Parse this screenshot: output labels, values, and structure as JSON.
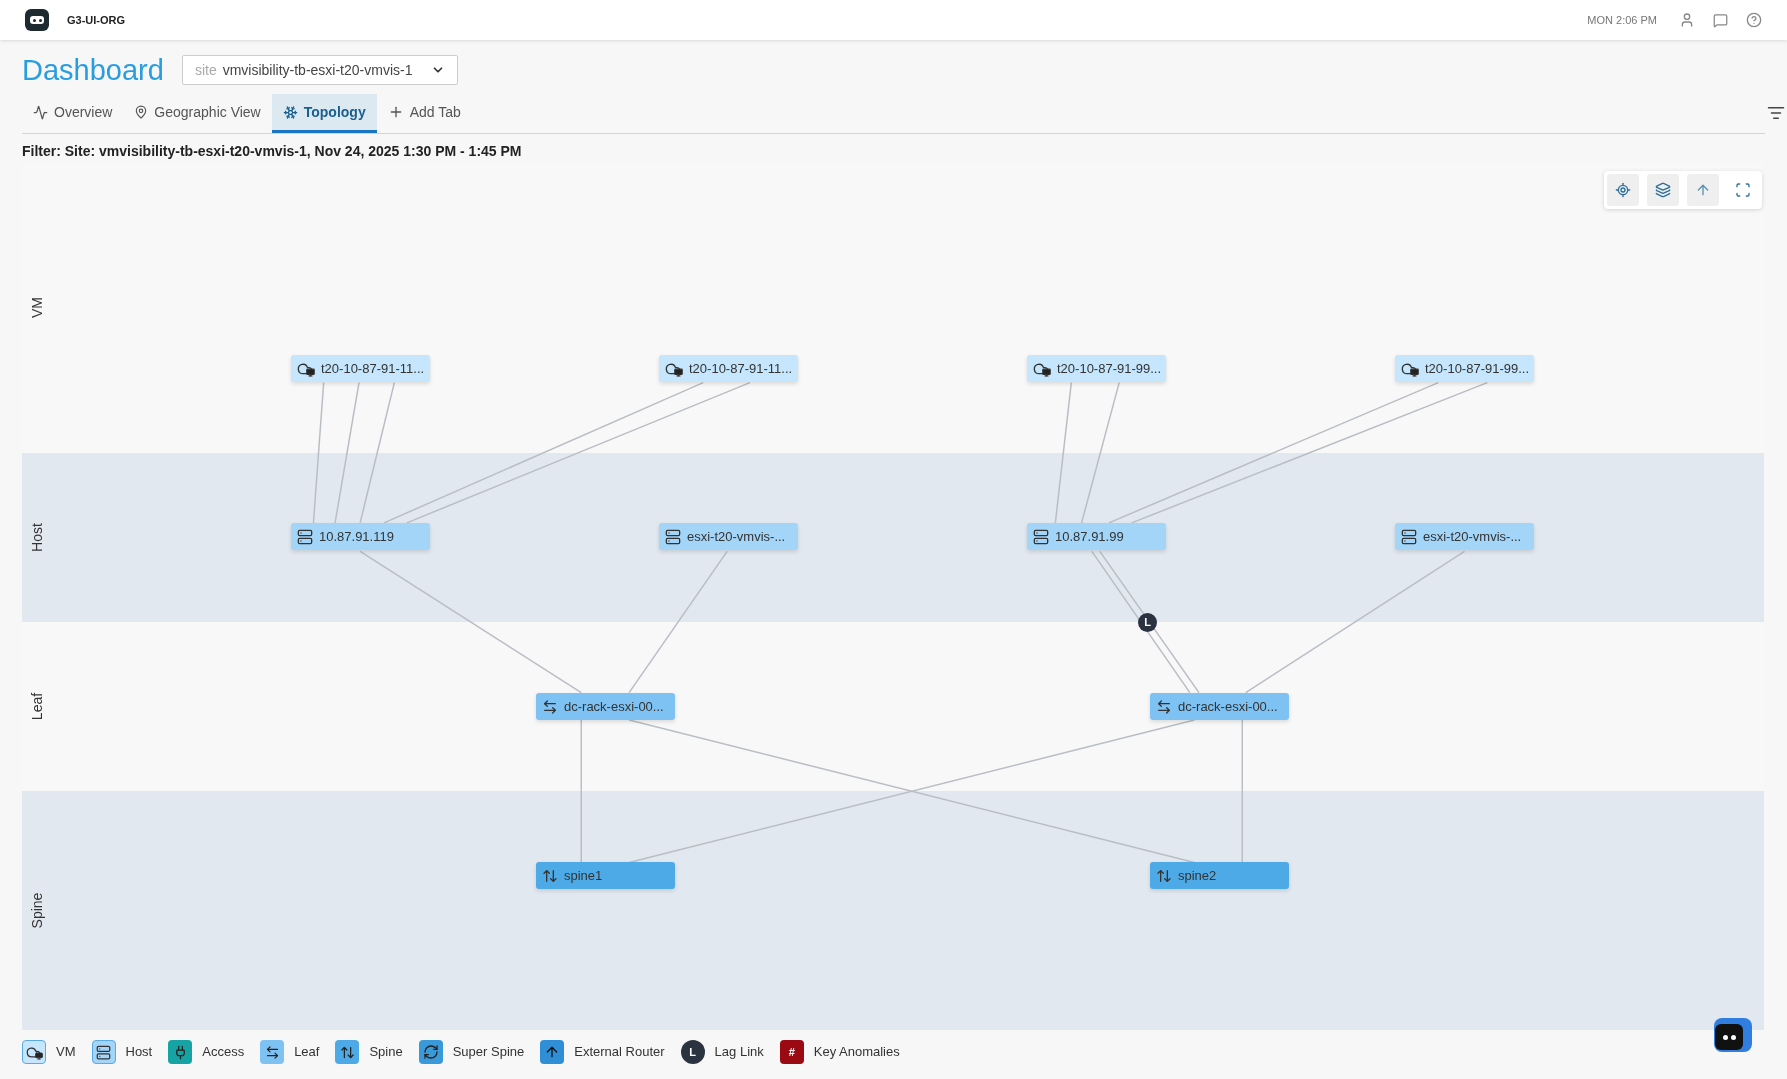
{
  "header": {
    "org": "G3-UI-ORG",
    "time": "MON 2:06 PM"
  },
  "page": {
    "title": "Dashboard",
    "site_select": {
      "prefix": "site",
      "value": "vmvisibility-tb-esxi-t20-vmvis-1"
    }
  },
  "tabs": [
    {
      "label": "Overview",
      "kind": "overview",
      "selected": false
    },
    {
      "label": "Geographic View",
      "kind": "geo",
      "selected": false
    },
    {
      "label": "Topology",
      "kind": "topology",
      "selected": true
    },
    {
      "label": "Add Tab",
      "kind": "add",
      "selected": false
    }
  ],
  "filter": "Filter: Site: vmvisibility-tb-esxi-t20-vmvis-1, Nov 24, 2025 1:30 PM - 1:45 PM",
  "topology": {
    "lanes": [
      {
        "label": "VM",
        "kind": "vm",
        "nodes": [
          {
            "label": "t20-10-87-91-11..."
          },
          {
            "label": "t20-10-87-91-11..."
          },
          {
            "label": "t20-10-87-91-99..."
          },
          {
            "label": "t20-10-87-91-99..."
          }
        ]
      },
      {
        "label": "Host",
        "kind": "host",
        "nodes": [
          {
            "label": "10.87.91.119"
          },
          {
            "label": "esxi-t20-vmvis-..."
          },
          {
            "label": "10.87.91.99"
          },
          {
            "label": "esxi-t20-vmvis-..."
          }
        ]
      },
      {
        "label": "Leaf",
        "kind": "leaf",
        "nodes": [
          {
            "label": "dc-rack-esxi-00..."
          },
          {
            "label": "dc-rack-esxi-00..."
          }
        ]
      },
      {
        "label": "Spine",
        "kind": "spine",
        "nodes": [
          {
            "label": "spine1"
          },
          {
            "label": "spine2"
          }
        ]
      }
    ],
    "lag_link": {
      "label": "L"
    }
  },
  "legend": [
    {
      "label": "VM",
      "kind": "vm"
    },
    {
      "label": "Host",
      "kind": "host"
    },
    {
      "label": "Access",
      "kind": "access"
    },
    {
      "label": "Leaf",
      "kind": "leaf"
    },
    {
      "label": "Spine",
      "kind": "spine"
    },
    {
      "label": "Super Spine",
      "kind": "superspine"
    },
    {
      "label": "External Router",
      "kind": "router"
    },
    {
      "label": "Lag Link",
      "kind": "lag",
      "glyph": "L"
    },
    {
      "label": "Key Anomalies",
      "kind": "anomaly",
      "glyph": "#"
    }
  ]
}
